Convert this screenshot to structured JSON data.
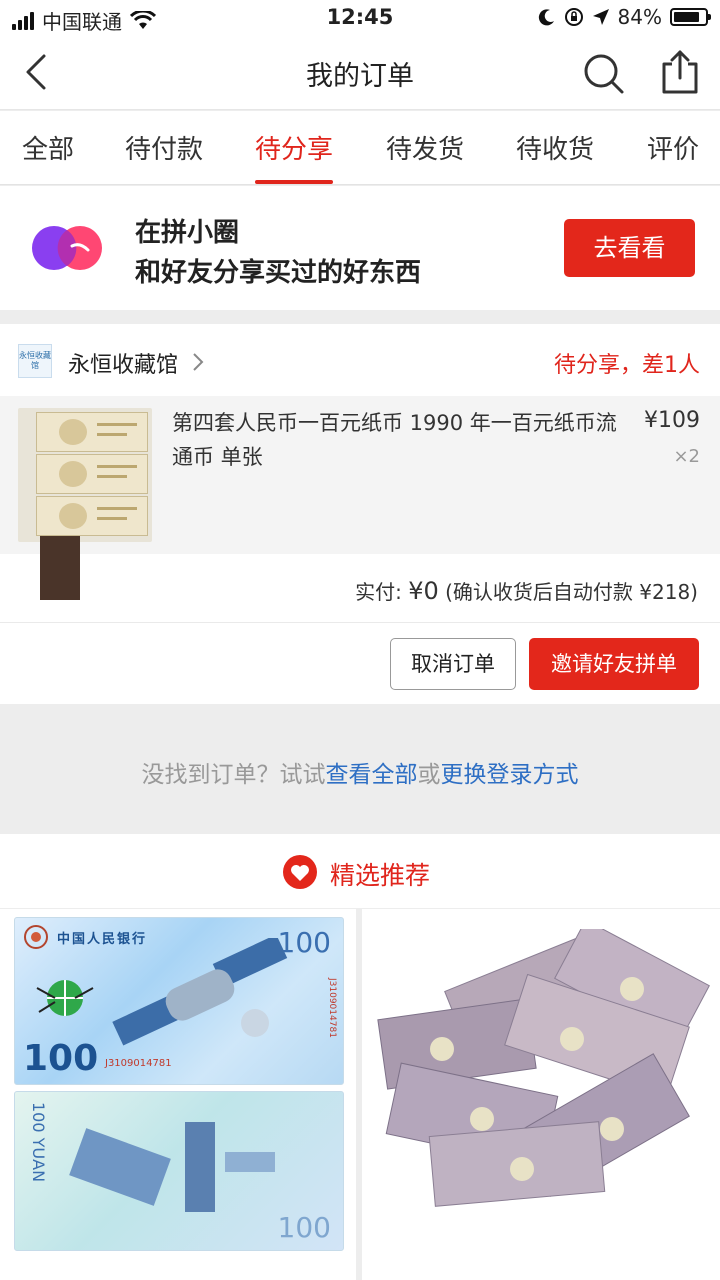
{
  "status_bar": {
    "carrier": "中国联通",
    "time": "12:45",
    "battery": "84%",
    "battery_level": 0.84
  },
  "nav": {
    "title": "我的订单"
  },
  "tabs": [
    {
      "label": "全部"
    },
    {
      "label": "待付款"
    },
    {
      "label": "待分享",
      "active": true
    },
    {
      "label": "待发货"
    },
    {
      "label": "待收货"
    },
    {
      "label": "评价"
    }
  ],
  "banner": {
    "line1": "在拼小圈",
    "line2": "和好友分享买过的好东西",
    "button": "去看看"
  },
  "order": {
    "shop_logo_text": "永恒收藏馆",
    "shop_name": "永恒收藏馆",
    "status": "待分享，差1人",
    "product_title": "第四套人民币一百元纸币 1990 年一百元纸币流通币 单张",
    "price": "¥109",
    "quantity": "×2",
    "paid_label": "实付: ",
    "paid_amount": "¥0",
    "paid_note": "(确认收货后自动付款 ¥218)",
    "cancel_button": "取消订单",
    "invite_button": "邀请好友拼单"
  },
  "not_found": {
    "prefix": "没找到订单？试试",
    "link_all": "查看全部",
    "or": "或",
    "link_login": "更换登录方式"
  },
  "recommend": {
    "title": "精选推荐",
    "items": [
      {
        "bank": "中国人民银行",
        "denomination": "100",
        "serial": "J3109014781",
        "yuan": "YUAN"
      },
      {}
    ]
  },
  "colors": {
    "accent": "#e0251c",
    "button_red": "#e3271b",
    "link_blue": "#2e6fc4"
  }
}
